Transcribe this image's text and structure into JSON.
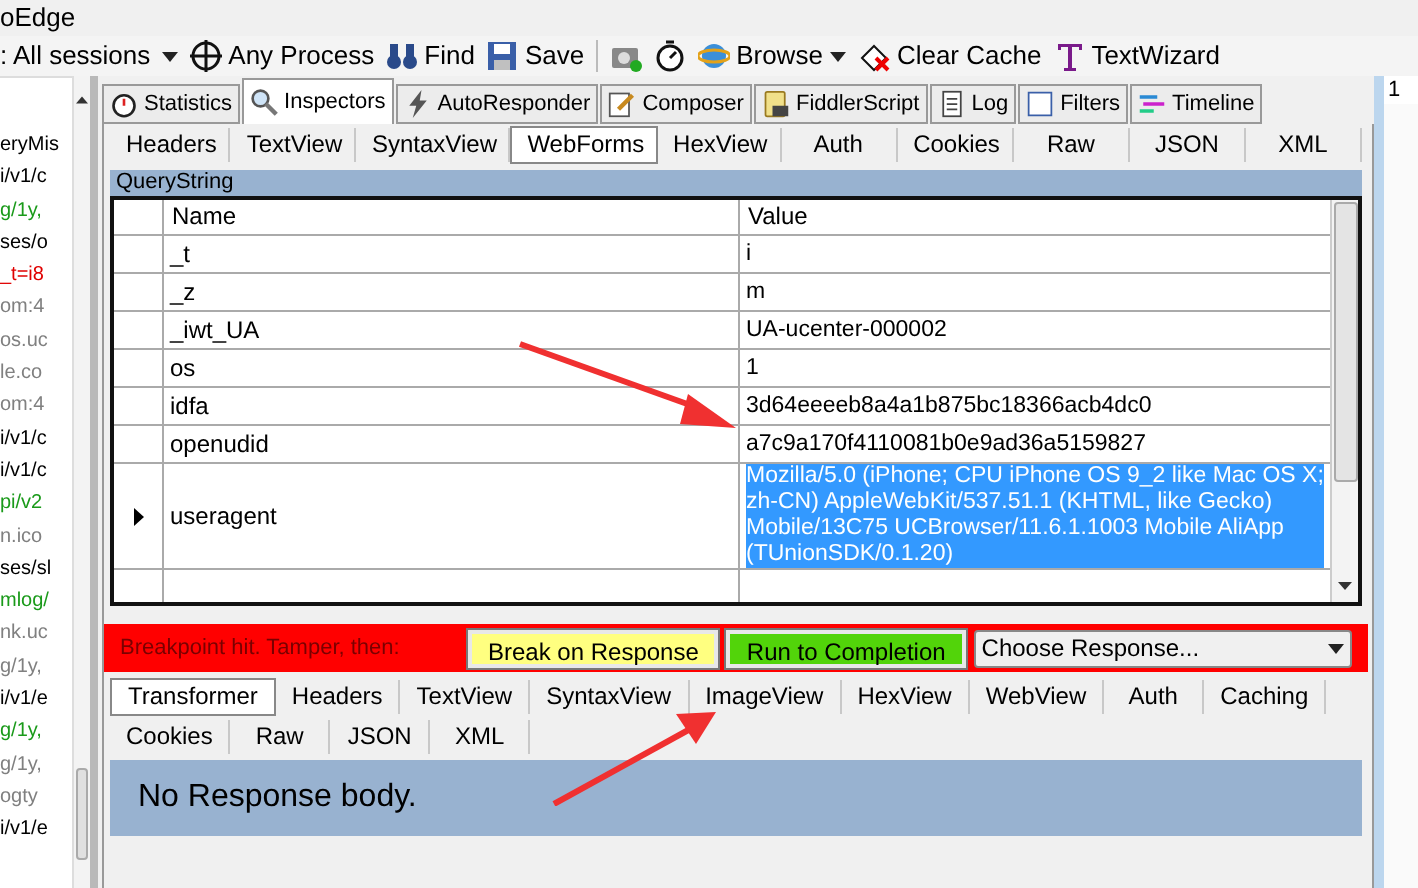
{
  "window": {
    "title": "oEdge"
  },
  "toolbar": {
    "session_filter": ": All sessions",
    "items": [
      {
        "kind": "process",
        "label": "Any Process"
      },
      {
        "kind": "find",
        "label": "Find"
      },
      {
        "kind": "save",
        "label": "Save"
      },
      {
        "kind": "camera"
      },
      {
        "kind": "timer"
      },
      {
        "kind": "browse",
        "label": "Browse"
      },
      {
        "kind": "clear",
        "label": "Clear Cache"
      },
      {
        "kind": "wizard",
        "label": "TextWizard"
      }
    ]
  },
  "sessions": [
    {
      "text": "eryMis",
      "color": "#000000"
    },
    {
      "text": "i/v1/c",
      "color": "#000000"
    },
    {
      "text": "g/1y,",
      "color": "#1a9a1a"
    },
    {
      "text": "ses/o",
      "color": "#000000"
    },
    {
      "text": "_t=i8",
      "color": "#e00000"
    },
    {
      "text": "om:4",
      "color": "#808080"
    },
    {
      "text": "os.uc",
      "color": "#808080"
    },
    {
      "text": "le.co",
      "color": "#808080"
    },
    {
      "text": "om:4",
      "color": "#808080"
    },
    {
      "text": "i/v1/c",
      "color": "#000000"
    },
    {
      "text": "i/v1/c",
      "color": "#000000"
    },
    {
      "text": "pi/v2",
      "color": "#1a9a1a"
    },
    {
      "text": "n.ico",
      "color": "#808080"
    },
    {
      "text": "ses/sl",
      "color": "#000000"
    },
    {
      "text": "mlog/",
      "color": "#1a9a1a"
    },
    {
      "text": "nk.uc",
      "color": "#808080"
    },
    {
      "text": "g/1y,",
      "color": "#808080"
    },
    {
      "text": "i/v1/e",
      "color": "#000000"
    },
    {
      "text": "g/1y,",
      "color": "#1a9a1a"
    },
    {
      "text": "g/1y,",
      "color": "#808080"
    },
    {
      "text": "ogty",
      "color": "#808080"
    },
    {
      "text": "i/v1/e",
      "color": "#000000"
    }
  ],
  "main_tabs": [
    {
      "kind": "statistics",
      "label": "Statistics",
      "selected": false
    },
    {
      "kind": "inspectors",
      "label": "Inspectors",
      "selected": true
    },
    {
      "kind": "autoresponder",
      "label": "AutoResponder",
      "selected": false
    },
    {
      "kind": "composer",
      "label": "Composer",
      "selected": false
    },
    {
      "kind": "script",
      "label": "FiddlerScript",
      "selected": false
    },
    {
      "kind": "log",
      "label": "Log",
      "selected": false
    },
    {
      "kind": "filters",
      "label": "Filters",
      "selected": false
    },
    {
      "kind": "timeline",
      "label": "Timeline",
      "selected": false
    }
  ],
  "request_tabs": [
    {
      "label": "Headers",
      "selected": false
    },
    {
      "label": "TextView",
      "selected": false
    },
    {
      "label": "SyntaxView",
      "selected": false
    },
    {
      "label": "WebForms",
      "selected": true
    },
    {
      "label": "HexView",
      "selected": false
    },
    {
      "label": "Auth",
      "selected": false
    },
    {
      "label": "Cookies",
      "selected": false
    },
    {
      "label": "Raw",
      "selected": false
    },
    {
      "label": "JSON",
      "selected": false
    },
    {
      "label": "XML",
      "selected": false
    }
  ],
  "querystring": {
    "title": "QueryString",
    "columns": [
      "Name",
      "Value"
    ],
    "rows": [
      {
        "name": "_t",
        "value": "i",
        "selected": false
      },
      {
        "name": "_z",
        "value": "m",
        "selected": false
      },
      {
        "name": "_iwt_UA",
        "value": "UA-ucenter-000002",
        "selected": false
      },
      {
        "name": "os",
        "value": "1",
        "selected": false
      },
      {
        "name": "idfa",
        "value": "3d64eeeeb8a4a1b875bc18366acb4dc0",
        "selected": false
      },
      {
        "name": "openudid",
        "value": "a7c9a170f4110081b0e9ad36a5159827",
        "selected": false
      },
      {
        "name": "useragent",
        "value": "Mozilla/5.0 (iPhone; CPU iPhone OS 9_2 like Mac OS X; zh-CN) AppleWebKit/537.51.1 (KHTML, like Gecko) Mobile/13C75 UCBrowser/11.6.1.1003 Mobile  AliApp (TUnionSDK/0.1.20)",
        "selected": true
      }
    ]
  },
  "breakpoint": {
    "message": "Breakpoint hit. Tamper, then:",
    "buttons": [
      {
        "kind": "break",
        "label": "Break on Response"
      },
      {
        "kind": "run",
        "label": "Run to Completion"
      }
    ],
    "choose_response": {
      "value": "Choose Response..."
    }
  },
  "response_tabs": [
    [
      {
        "label": "Transformer",
        "selected": true
      },
      {
        "label": "Headers",
        "selected": false
      },
      {
        "label": "TextView",
        "selected": false
      },
      {
        "label": "SyntaxView",
        "selected": false
      },
      {
        "label": "ImageView",
        "selected": false
      },
      {
        "label": "HexView",
        "selected": false
      },
      {
        "label": "WebView",
        "selected": false
      },
      {
        "label": "Auth",
        "selected": false
      },
      {
        "label": "Caching",
        "selected": false
      }
    ],
    [
      {
        "label": "Cookies",
        "selected": false
      },
      {
        "label": "Raw",
        "selected": false
      },
      {
        "label": "JSON",
        "selected": false
      },
      {
        "label": "XML",
        "selected": false
      }
    ]
  ],
  "response_body": "No Response body.",
  "right_strip": {
    "text": "1"
  }
}
